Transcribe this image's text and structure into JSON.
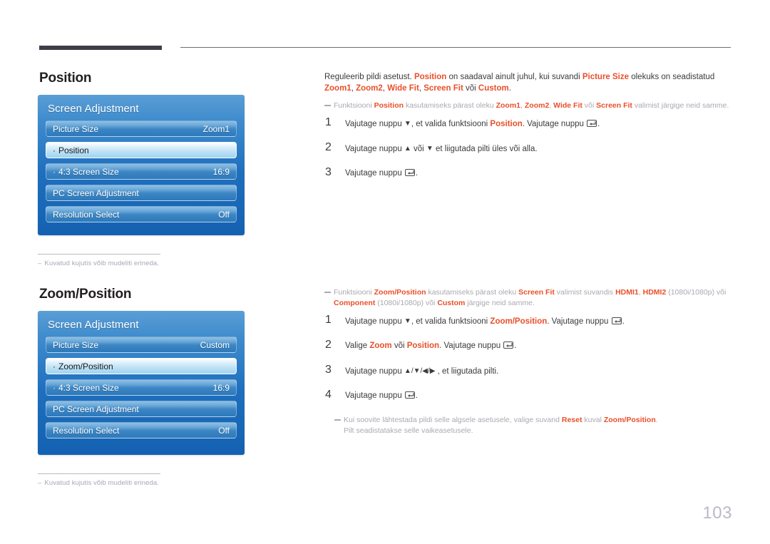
{
  "page": {
    "number": "103"
  },
  "sections": [
    {
      "heading": "Position",
      "panel": {
        "title": "Screen Adjustment",
        "rows": [
          {
            "bullet": "",
            "label": "Picture Size",
            "value": "Zoom1",
            "selected": false
          },
          {
            "bullet": "·",
            "label": "Position",
            "value": "",
            "selected": true
          },
          {
            "bullet": "·",
            "label": "4:3 Screen Size",
            "value": "16:9",
            "selected": false
          },
          {
            "bullet": "",
            "label": "PC Screen Adjustment",
            "value": "",
            "selected": false
          },
          {
            "bullet": "",
            "label": "Resolution Select",
            "value": "Off",
            "selected": false
          }
        ]
      },
      "footnote": {
        "dash": "–",
        "text": "Kuvatud kujutis võib mudeliti erineda."
      },
      "body": {
        "intro_parts": [
          {
            "t": "Reguleerib pildi asetust. ",
            "s": "n"
          },
          {
            "t": "Position",
            "s": "h"
          },
          {
            "t": " on saadaval ainult juhul, kui suvandi ",
            "s": "n"
          },
          {
            "t": "Picture Size",
            "s": "h"
          },
          {
            "t": " olekuks on seadistatud ",
            "s": "n"
          },
          {
            "t": "Zoom1",
            "s": "h"
          },
          {
            "t": ", ",
            "s": "n"
          },
          {
            "t": "Zoom2",
            "s": "h"
          },
          {
            "t": ", ",
            "s": "n"
          },
          {
            "t": "Wide Fit",
            "s": "h"
          },
          {
            "t": ", ",
            "s": "n"
          },
          {
            "t": "Screen Fit",
            "s": "h"
          },
          {
            "t": " või ",
            "s": "n"
          },
          {
            "t": "Custom",
            "s": "h"
          },
          {
            "t": ".",
            "s": "n"
          }
        ],
        "note_parts": [
          {
            "t": "Funktsiooni ",
            "s": "d"
          },
          {
            "t": "Position",
            "s": "h"
          },
          {
            "t": " kasutamiseks pärast oleku ",
            "s": "d"
          },
          {
            "t": "Zoom1",
            "s": "h"
          },
          {
            "t": ", ",
            "s": "d"
          },
          {
            "t": "Zoom2",
            "s": "h"
          },
          {
            "t": ", ",
            "s": "d"
          },
          {
            "t": "Wide Fit",
            "s": "h"
          },
          {
            "t": " või ",
            "s": "d"
          },
          {
            "t": "Screen Fit",
            "s": "h"
          },
          {
            "t": " valimist järgige neid samme.",
            "s": "d"
          }
        ],
        "steps": [
          {
            "num": "1",
            "parts": [
              {
                "t": "Vajutage nuppu ",
                "s": "n"
              },
              {
                "t": "▼",
                "s": "a"
              },
              {
                "t": ", et valida funktsiooni ",
                "s": "n"
              },
              {
                "t": "Position",
                "s": "h"
              },
              {
                "t": ". Vajutage nuppu ",
                "s": "n"
              },
              {
                "t": "",
                "s": "e"
              },
              {
                "t": ".",
                "s": "n"
              }
            ]
          },
          {
            "num": "2",
            "parts": [
              {
                "t": "Vajutage nuppu ",
                "s": "n"
              },
              {
                "t": "▲",
                "s": "a"
              },
              {
                "t": " või ",
                "s": "n"
              },
              {
                "t": "▼",
                "s": "a"
              },
              {
                "t": " et liigutada pilti üles või alla.",
                "s": "n"
              }
            ]
          },
          {
            "num": "3",
            "parts": [
              {
                "t": "Vajutage nuppu ",
                "s": "n"
              },
              {
                "t": "",
                "s": "e"
              },
              {
                "t": ".",
                "s": "n"
              }
            ]
          }
        ]
      }
    },
    {
      "heading": "Zoom/Position",
      "panel": {
        "title": "Screen Adjustment",
        "rows": [
          {
            "bullet": "",
            "label": "Picture Size",
            "value": "Custom",
            "selected": false
          },
          {
            "bullet": "·",
            "label": "Zoom/Position",
            "value": "",
            "selected": true
          },
          {
            "bullet": "·",
            "label": "4:3 Screen Size",
            "value": "16:9",
            "selected": false
          },
          {
            "bullet": "",
            "label": "PC Screen Adjustment",
            "value": "",
            "selected": false
          },
          {
            "bullet": "",
            "label": "Resolution Select",
            "value": "Off",
            "selected": false
          }
        ]
      },
      "footnote": {
        "dash": "–",
        "text": "Kuvatud kujutis võib mudeliti erineda."
      },
      "body": {
        "note_parts": [
          {
            "t": "Funktsiooni ",
            "s": "d"
          },
          {
            "t": "Zoom/Position",
            "s": "h"
          },
          {
            "t": " kasutamiseks pärast oleku ",
            "s": "d"
          },
          {
            "t": "Screen Fit",
            "s": "h"
          },
          {
            "t": " valimist suvandis ",
            "s": "d"
          },
          {
            "t": "HDMI1",
            "s": "h"
          },
          {
            "t": ", ",
            "s": "d"
          },
          {
            "t": "HDMI2",
            "s": "h"
          },
          {
            "t": " (1080i/1080p) või ",
            "s": "d"
          },
          {
            "t": "Component",
            "s": "h"
          },
          {
            "t": " (1080i/1080p) või ",
            "s": "d"
          },
          {
            "t": "Custom",
            "s": "h"
          },
          {
            "t": " järgige neid samme.",
            "s": "d"
          }
        ],
        "steps": [
          {
            "num": "1",
            "parts": [
              {
                "t": "Vajutage nuppu ",
                "s": "n"
              },
              {
                "t": "▼",
                "s": "a"
              },
              {
                "t": ", et valida funktsiooni ",
                "s": "n"
              },
              {
                "t": "Zoom/Position",
                "s": "h"
              },
              {
                "t": ". Vajutage nuppu ",
                "s": "n"
              },
              {
                "t": "",
                "s": "e"
              },
              {
                "t": ".",
                "s": "n"
              }
            ]
          },
          {
            "num": "2",
            "parts": [
              {
                "t": "Valige ",
                "s": "n"
              },
              {
                "t": "Zoom",
                "s": "h"
              },
              {
                "t": " või ",
                "s": "n"
              },
              {
                "t": "Position",
                "s": "h"
              },
              {
                "t": ". Vajutage nuppu ",
                "s": "n"
              },
              {
                "t": "",
                "s": "e"
              },
              {
                "t": ".",
                "s": "n"
              }
            ]
          },
          {
            "num": "3",
            "parts": [
              {
                "t": "Vajutage nuppu ",
                "s": "n"
              },
              {
                "t": "▲/▼/◀/▶",
                "s": "a"
              },
              {
                "t": " , et liigutada pilti.",
                "s": "n"
              }
            ]
          },
          {
            "num": "4",
            "parts": [
              {
                "t": "Vajutage nuppu ",
                "s": "n"
              },
              {
                "t": "",
                "s": "e"
              },
              {
                "t": ".",
                "s": "n"
              }
            ]
          }
        ],
        "tail_note_parts": [
          {
            "t": "Kui soovite lähtestada pildi selle algsele asetusele, valige suvand ",
            "s": "d"
          },
          {
            "t": "Reset",
            "s": "h"
          },
          {
            "t": " kuval ",
            "s": "d"
          },
          {
            "t": "Zoom/Position",
            "s": "h"
          },
          {
            "t": ".",
            "s": "d"
          }
        ],
        "tail_note_line2": "Pilt seadistatakse selle vaikeasetusele."
      }
    }
  ]
}
